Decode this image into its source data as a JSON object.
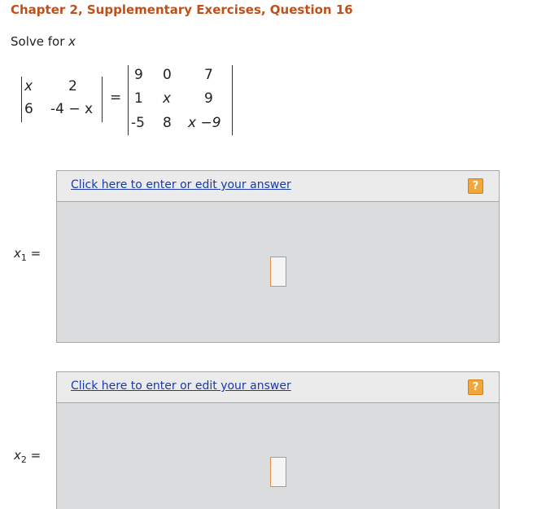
{
  "header": {
    "title": "Chapter 2, Supplementary Exercises, Question 16"
  },
  "prompt": {
    "text": "Solve for ",
    "variable": "x"
  },
  "equation": {
    "left_matrix": [
      [
        "x",
        "2"
      ],
      [
        "6",
        "-4 − x"
      ]
    ],
    "equals": "=",
    "right_matrix": [
      [
        "9",
        "0",
        "7"
      ],
      [
        "1",
        "x",
        "9"
      ],
      [
        "-5",
        "8",
        "x −9"
      ]
    ]
  },
  "answers": [
    {
      "var": "x",
      "sub": "1",
      "eq": " =",
      "link": "Click here to enter or edit your answer",
      "help": "?"
    },
    {
      "var": "x",
      "sub": "2",
      "eq": " =",
      "link": "Click here to enter or edit your answer",
      "help": "?"
    }
  ],
  "colors": {
    "title": "#c0501a",
    "link": "#1a3aa8",
    "help_icon": "#f3a73a",
    "answer_bg": "#dadcde"
  }
}
